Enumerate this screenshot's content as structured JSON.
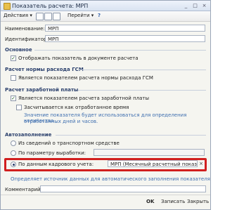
{
  "window": {
    "title": "Показатель расчета: МРП",
    "buttons": {
      "minimize": "_",
      "maximize": "□",
      "close": "×"
    }
  },
  "toolbar": {
    "actions_label": "Действия ▾",
    "help_label": "Перейти ▾",
    "question": "?"
  },
  "fields": {
    "name_label": "Наименование:",
    "name_value": "МРП",
    "id_label": "Идентификатор:",
    "id_value": "МРП"
  },
  "sections": {
    "main": {
      "title": "Основное",
      "checkbox_label": "Отображать показатель в документе расчета",
      "checked": true
    },
    "fuel": {
      "title": "Расчет нормы расхода ГСМ",
      "checkbox_label": "Является показателем расчета нормы расхода ГСМ",
      "checked": false
    },
    "salary": {
      "title": "Расчет заработной платы",
      "checkbox_label": "Является показателем расчета заработной платы",
      "checked": true,
      "sub_checkbox_label": "Засчитывается как отработанное время",
      "sub_checked": false,
      "hint": "Значение показателя будет использоваться для определения количества",
      "hint2": "отработанных дней и часов."
    },
    "autofill": {
      "title": "Автозаполнение",
      "options": [
        {
          "label": "Из сведений о транспортном средстве",
          "checked": false
        },
        {
          "label": "По параметру выработки:",
          "checked": false
        },
        {
          "label": "По данным кадрового учета:",
          "checked": true
        }
      ],
      "hr_value": "МРП (Месячный расчетный показат...",
      "hint": "Определяет источник данных для автоматического заполнения показателя"
    }
  },
  "comment": {
    "label": "Комментарий:",
    "value": ""
  },
  "footer": {
    "ok": "OK",
    "save": "Записать",
    "close": "Закрыть"
  },
  "colors": {
    "highlight": "#d11f1f",
    "section": "#2a3f6c",
    "hint": "#3f6fb0"
  }
}
